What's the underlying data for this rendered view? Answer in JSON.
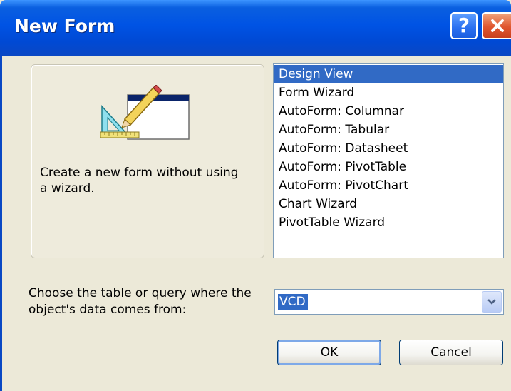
{
  "window": {
    "title": "New Form",
    "help_glyph": "?",
    "close_icon": "close-icon"
  },
  "preview": {
    "description": "Create a new form without using a wizard."
  },
  "form_types": {
    "items": [
      {
        "label": "Design View",
        "selected": true
      },
      {
        "label": "Form Wizard",
        "selected": false
      },
      {
        "label": "AutoForm:  Columnar",
        "selected": false
      },
      {
        "label": "AutoForm:  Tabular",
        "selected": false
      },
      {
        "label": "AutoForm:  Datasheet",
        "selected": false
      },
      {
        "label": "AutoForm:  PivotTable",
        "selected": false
      },
      {
        "label": "AutoForm:  PivotChart",
        "selected": false
      },
      {
        "label": "Chart Wizard",
        "selected": false
      },
      {
        "label": "PivotTable Wizard",
        "selected": false
      }
    ]
  },
  "source": {
    "label": "Choose the table or query where the object's data comes from:",
    "value": "VCD"
  },
  "buttons": {
    "ok": "OK",
    "cancel": "Cancel"
  },
  "colors": {
    "titlebar": "#0053e4",
    "selection": "#316ac5",
    "dialog_bg": "#ece9d8"
  }
}
